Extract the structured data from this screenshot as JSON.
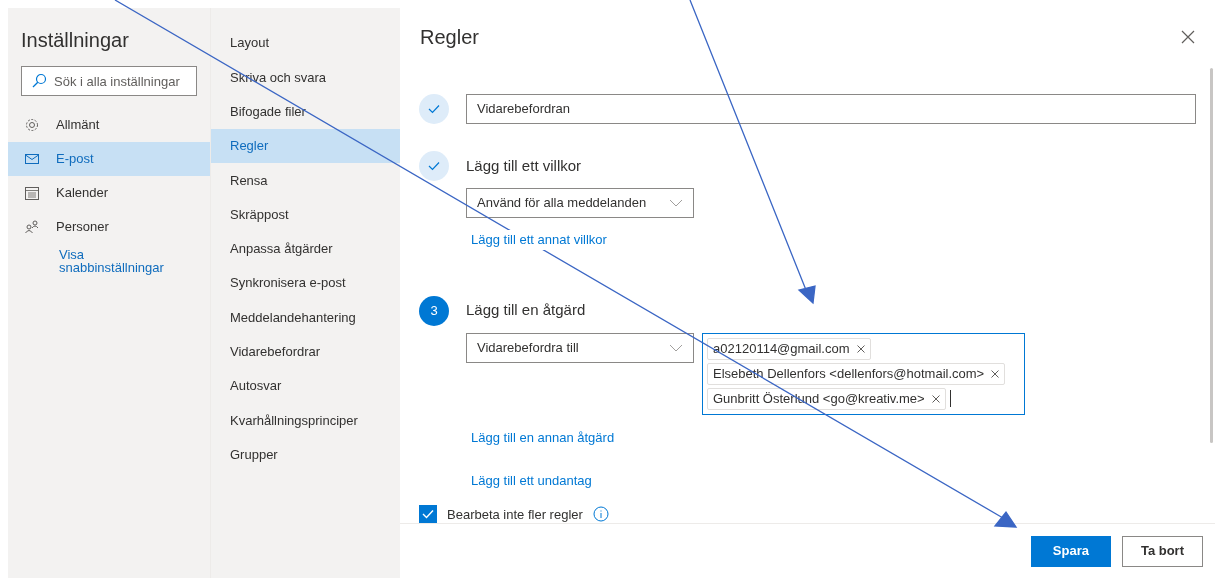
{
  "nav": {
    "title": "Inställningar",
    "search": {
      "placeholder": "Sök i alla inställningar"
    },
    "items": [
      {
        "label": "Allmänt",
        "selected": false
      },
      {
        "label": "E-post",
        "selected": true
      },
      {
        "label": "Kalender",
        "selected": false
      },
      {
        "label": "Personer",
        "selected": false
      }
    ],
    "link": "Visa snabbinställningar"
  },
  "subnav": {
    "items": [
      {
        "label": "Layout",
        "selected": false
      },
      {
        "label": "Skriva och svara",
        "selected": false
      },
      {
        "label": "Bifogade filer",
        "selected": false
      },
      {
        "label": "Regler",
        "selected": true
      },
      {
        "label": "Rensa",
        "selected": false
      },
      {
        "label": "Skräppost",
        "selected": false
      },
      {
        "label": "Anpassa åtgärder",
        "selected": false
      },
      {
        "label": "Synkronisera e-post",
        "selected": false
      },
      {
        "label": "Meddelandehantering",
        "selected": false
      },
      {
        "label": "Vidarebefordrar",
        "selected": false
      },
      {
        "label": "Autosvar",
        "selected": false
      },
      {
        "label": "Kvarhållningsprinciper",
        "selected": false
      },
      {
        "label": "Grupper",
        "selected": false
      }
    ]
  },
  "panel": {
    "title": "Regler",
    "name_step": {
      "done": true,
      "value": "Vidarebefordran"
    },
    "condition_step": {
      "done": true,
      "heading": "Lägg till ett villkor",
      "select": "Använd för alla meddelanden",
      "link": "Lägg till ett annat villkor"
    },
    "action_step": {
      "done": false,
      "number": "3",
      "heading": "Lägg till en åtgärd",
      "select": "Vidarebefordra till",
      "recipients": [
        "a02120114@gmail.com",
        "Elsebeth Dellenfors <dellenfors@hotmail.com>",
        "Gunbritt Österlund <go@kreativ.me>"
      ],
      "link": "Lägg till en annan åtgärd"
    },
    "exception_link": "Lägg till ett undantag",
    "stop_rule": {
      "label": "Bearbeta inte fler regler",
      "checked": true
    },
    "buttons": [
      {
        "label": "Spara",
        "kind": "primary"
      },
      {
        "label": "Ta bort",
        "kind": "secondary"
      }
    ]
  }
}
